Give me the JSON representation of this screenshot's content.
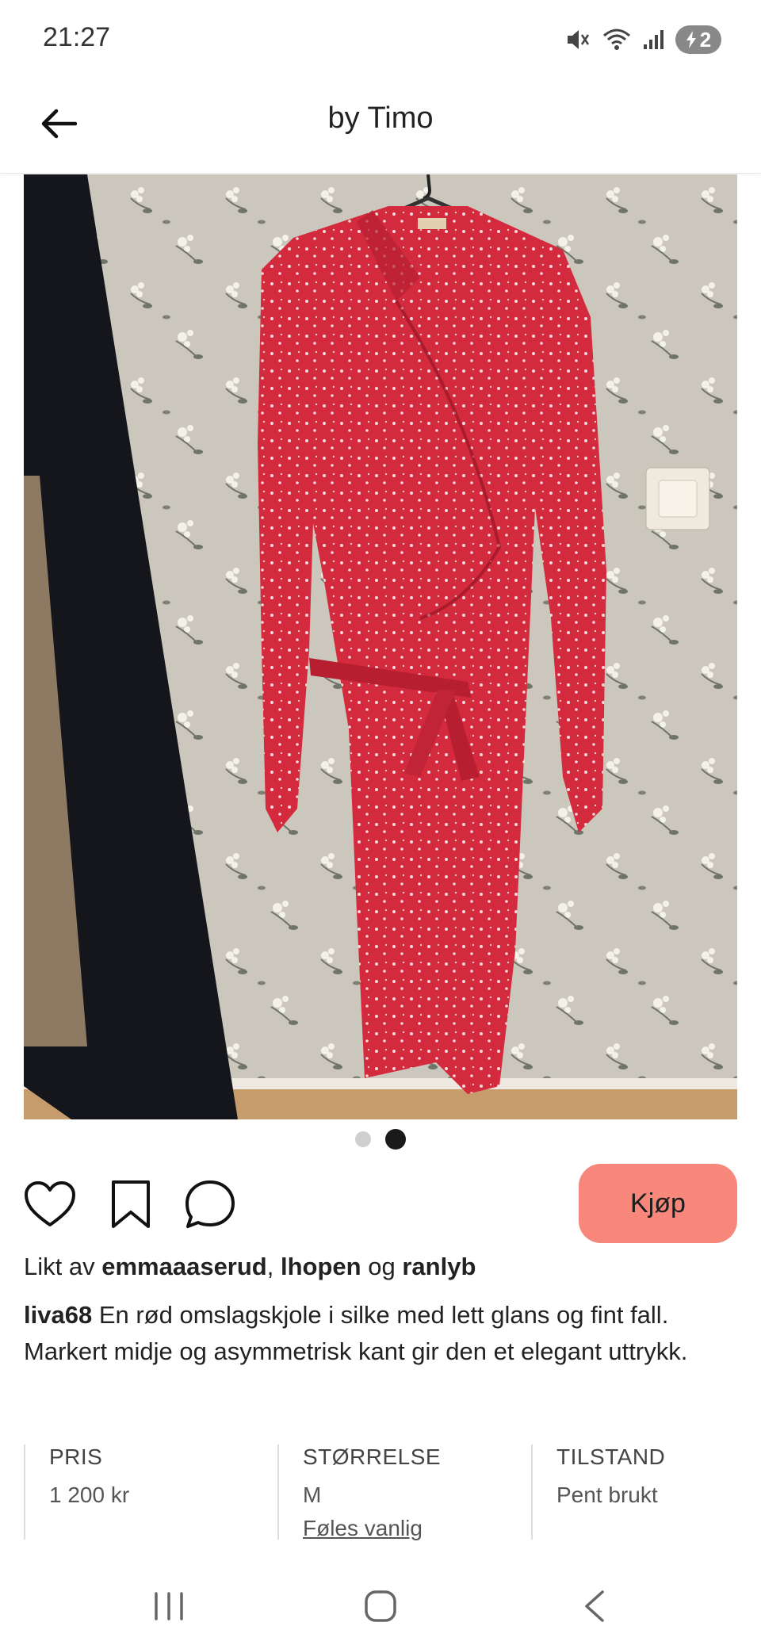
{
  "status_bar": {
    "time": "21:27",
    "battery": "2"
  },
  "header": {
    "title": "by Timo",
    "back_icon": "arrow-left-icon"
  },
  "photo": {
    "alt": "Red wrap dress with white floral print"
  },
  "carousel": {
    "current": 2,
    "total": 2
  },
  "actions": {
    "like_icon": "heart-icon",
    "save_icon": "bookmark-icon",
    "comment_icon": "comment-icon",
    "buy_label": "Kjøp"
  },
  "likes": {
    "prefix": "Likt av",
    "user1": "emmaaaserud",
    "sep": ",",
    "user2": "lhopen",
    "conj": "og",
    "user3": "ranlyb"
  },
  "description": {
    "user": "liva68",
    "text": "En rød omslagskjole i silke med lett glans og fint fall. Markert midje og asymmetrisk kant gir den et elegant uttrykk."
  },
  "details": {
    "price_label": "PRIS",
    "price_value": "1 200 kr",
    "size_label": "STØRRELSE",
    "size_value": "M",
    "size_fit": "Føles vanlig",
    "condition_label": "TILSTAND",
    "condition_value": "Pent brukt"
  },
  "colors": {
    "accent": "#f6877a",
    "dress": "#d42a3d"
  }
}
